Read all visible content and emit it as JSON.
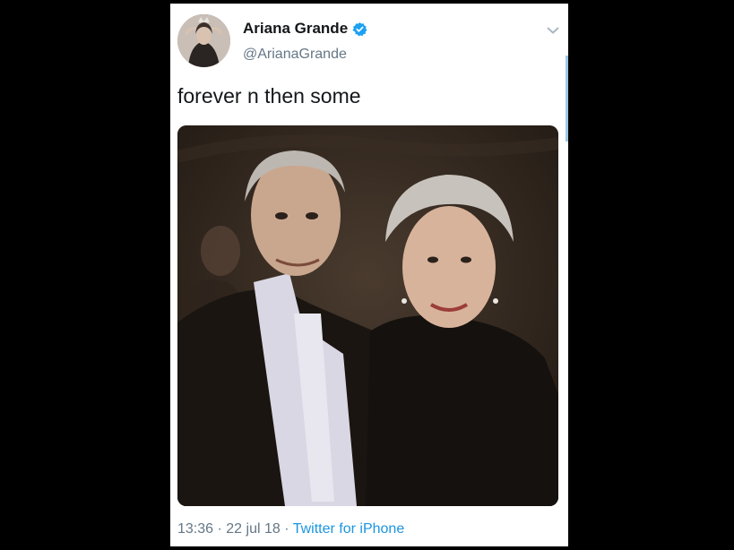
{
  "tweet": {
    "display_name": "Ariana Grande",
    "handle": "@ArianaGrande",
    "text": "forever n then some",
    "time": "13:36",
    "date": "22 jul 18",
    "source": "Twitter for iPhone",
    "separator": "·"
  },
  "icons": {
    "verified": "verified-badge-icon",
    "menu": "chevron-down-icon"
  },
  "colors": {
    "link": "#1b95e0",
    "muted": "#657786",
    "verified": "#1da1f2"
  }
}
